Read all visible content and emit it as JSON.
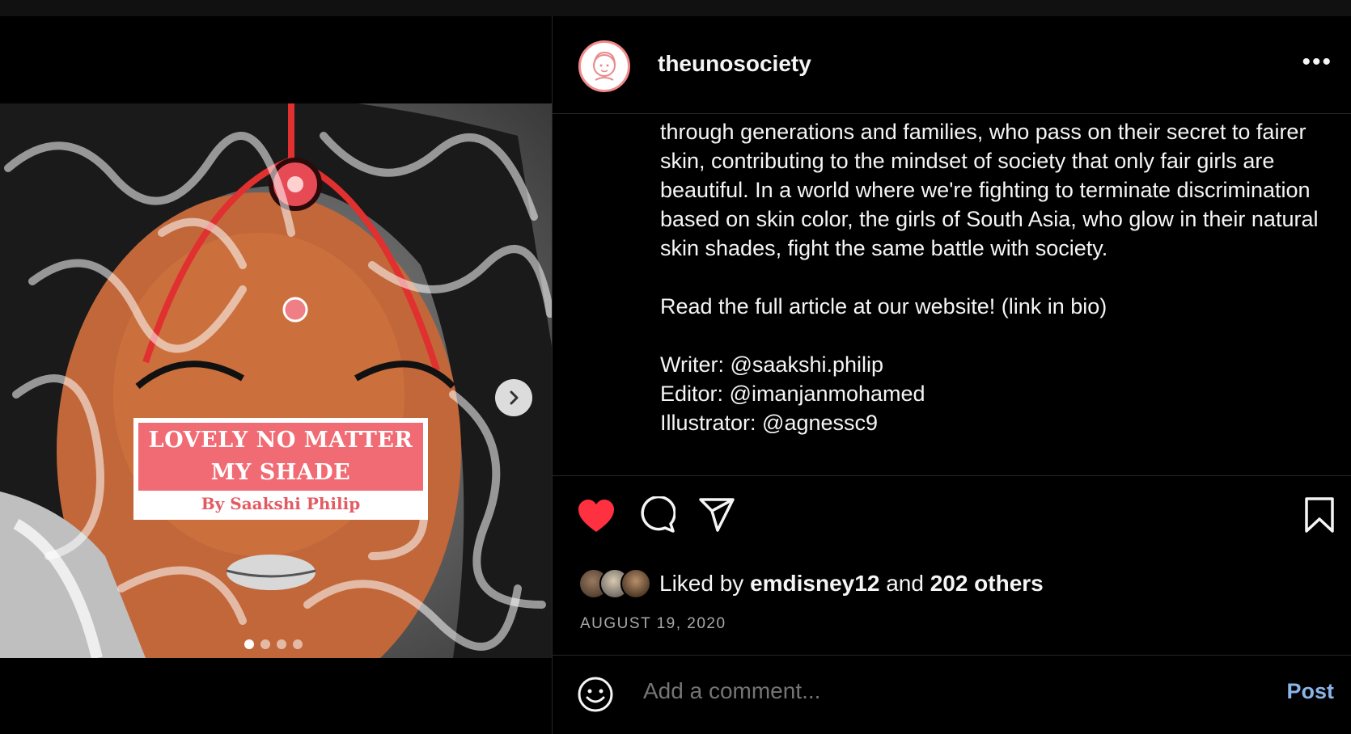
{
  "post": {
    "image": {
      "title_line1": "LOVELY NO MATTER",
      "title_line2": "MY SHADE",
      "byline": "By Saakshi Philip",
      "carousel_dots": 4,
      "active_dot": 0
    }
  },
  "header": {
    "username": "theunosociety",
    "more_label": "•••"
  },
  "caption": {
    "paragraph1": "through generations and families, who pass on their secret to fairer skin, contributing to the mindset of society that only fair girls are beautiful. In a world where we're fighting to terminate discrimination based on skin color, the girls of South Asia, who glow in their natural skin shades, fight the same battle with society.",
    "paragraph2": "Read the full article at our website! (link in bio)",
    "writer": "Writer: @saakshi.philip",
    "editor": "Editor: @imanjanmohamed",
    "illustrator": "Illustrator: @agnessc9"
  },
  "likes": {
    "prefix": "Liked by",
    "user": "emdisney12",
    "and": "and",
    "others": "202 others"
  },
  "date": "AUGUST 19, 2020",
  "comment": {
    "placeholder": "Add a comment...",
    "post_label": "Post"
  },
  "colors": {
    "like_red": "#ff3040",
    "post_blue": "#8ab4e8",
    "title_pink": "#f06b73"
  },
  "icons": [
    "heart-icon",
    "comment-icon",
    "share-icon",
    "bookmark-icon",
    "emoji-icon",
    "chevron-right-icon",
    "more-icon"
  ]
}
